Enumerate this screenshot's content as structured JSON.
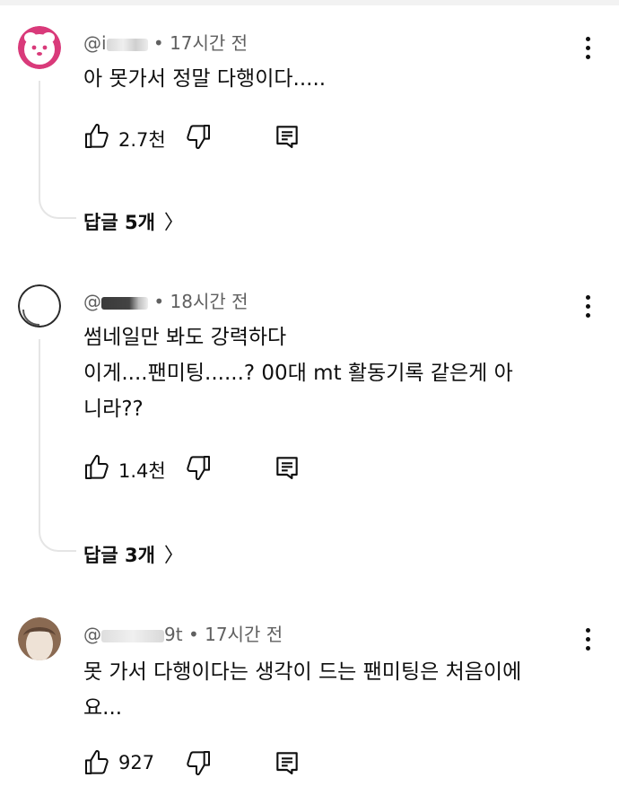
{
  "comments": [
    {
      "handle": "@i",
      "time": "17시간 전",
      "text_lines": [
        "아 못가서 정말 다행이다....."
      ],
      "likes": "2.7천",
      "replies": "답글 5개",
      "avatar": "pink-white-character"
    },
    {
      "handle": "@",
      "time": "18시간 전",
      "text_lines": [
        "썸네일만 봐도 강력하다",
        "이게....팬미팅......? 00대 mt 활동기록 같은게 아",
        "니라??"
      ],
      "likes": "1.4천",
      "replies": "답글 3개",
      "avatar": "white-circle-dark-outline"
    },
    {
      "handle": "@",
      "handle_suffix": "9t",
      "time": "17시간 전",
      "text_lines": [
        "못 가서 다행이다는 생각이 드는 팬미팅은 처음이에",
        "요..."
      ],
      "likes": "927",
      "avatar": "beige-portrait"
    }
  ],
  "separator": "•",
  "icons": [
    "thumb-up-icon",
    "thumb-down-icon",
    "reply-icon",
    "more-vert-icon",
    "chevron-right-icon"
  ]
}
